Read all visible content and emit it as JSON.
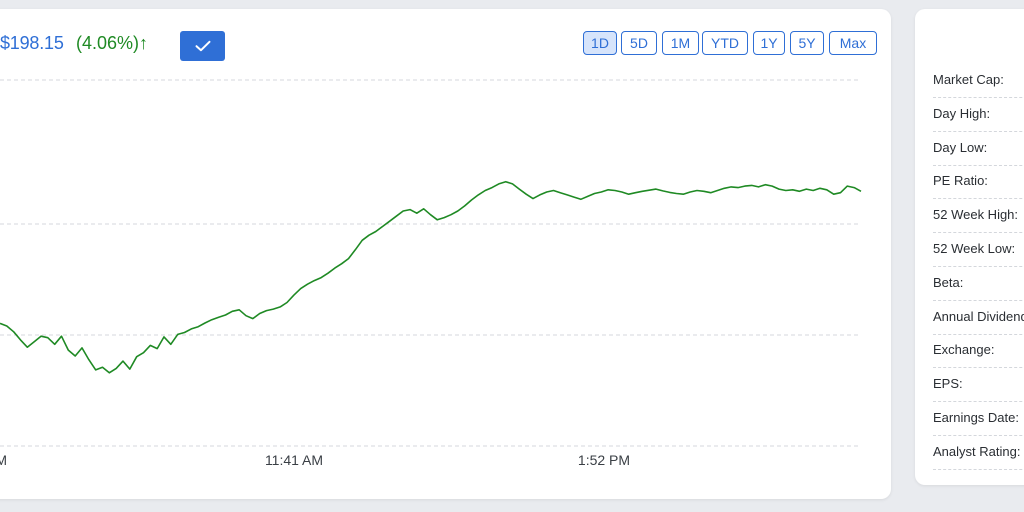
{
  "quote": {
    "price": "$198.15",
    "change": "(4.06%)↑"
  },
  "confirm_button": {
    "icon": "check-icon"
  },
  "ranges": [
    {
      "label": "1D",
      "active": true
    },
    {
      "label": "5D",
      "active": false
    },
    {
      "label": "1M",
      "active": false
    },
    {
      "label": "YTD",
      "active": false
    },
    {
      "label": "1Y",
      "active": false
    },
    {
      "label": "5Y",
      "active": false
    },
    {
      "label": "Max",
      "active": false
    }
  ],
  "colors": {
    "accent": "#2f6fd6",
    "positive": "#1f8a24",
    "grid": "#d4d7dc"
  },
  "chart_data": {
    "type": "line",
    "x_tick_labels": [
      "AM",
      "11:41 AM",
      "1:52 PM"
    ],
    "grid": true,
    "series": [
      {
        "values": [
          0.335,
          0.328,
          0.312,
          0.29,
          0.27,
          0.285,
          0.3,
          0.296,
          0.278,
          0.3,
          0.262,
          0.246,
          0.268,
          0.236,
          0.208,
          0.215,
          0.2,
          0.212,
          0.232,
          0.21,
          0.244,
          0.255,
          0.275,
          0.266,
          0.298,
          0.278,
          0.305,
          0.31,
          0.32,
          0.326,
          0.336,
          0.345,
          0.352,
          0.358,
          0.368,
          0.372,
          0.356,
          0.348,
          0.362,
          0.37,
          0.374,
          0.38,
          0.392,
          0.412,
          0.43,
          0.442,
          0.452,
          0.46,
          0.472,
          0.486,
          0.498,
          0.512,
          0.536,
          0.562,
          0.576,
          0.586,
          0.6,
          0.614,
          0.628,
          0.642,
          0.646,
          0.636,
          0.648,
          0.632,
          0.618,
          0.624,
          0.632,
          0.642,
          0.656,
          0.672,
          0.686,
          0.698,
          0.706,
          0.716,
          0.722,
          0.716,
          0.702,
          0.688,
          0.676,
          0.686,
          0.694,
          0.698,
          0.692,
          0.686,
          0.68,
          0.674,
          0.682,
          0.69,
          0.694,
          0.7,
          0.698,
          0.694,
          0.688,
          0.692,
          0.696,
          0.699,
          0.702,
          0.697,
          0.693,
          0.69,
          0.688,
          0.694,
          0.698,
          0.696,
          0.692,
          0.698,
          0.704,
          0.708,
          0.706,
          0.71,
          0.712,
          0.708,
          0.714,
          0.71,
          0.702,
          0.698,
          0.7,
          0.696,
          0.702,
          0.698,
          0.704,
          0.7,
          0.688,
          0.692,
          0.71,
          0.706,
          0.696
        ]
      }
    ]
  },
  "stats": {
    "labels": [
      "Market Cap:",
      "Day High:",
      "Day Low:",
      "PE Ratio:",
      "52 Week High:",
      "52 Week Low:",
      "Beta:",
      "Annual Dividend:",
      "Exchange:",
      "EPS:",
      "Earnings Date:",
      "Analyst Rating:"
    ]
  }
}
